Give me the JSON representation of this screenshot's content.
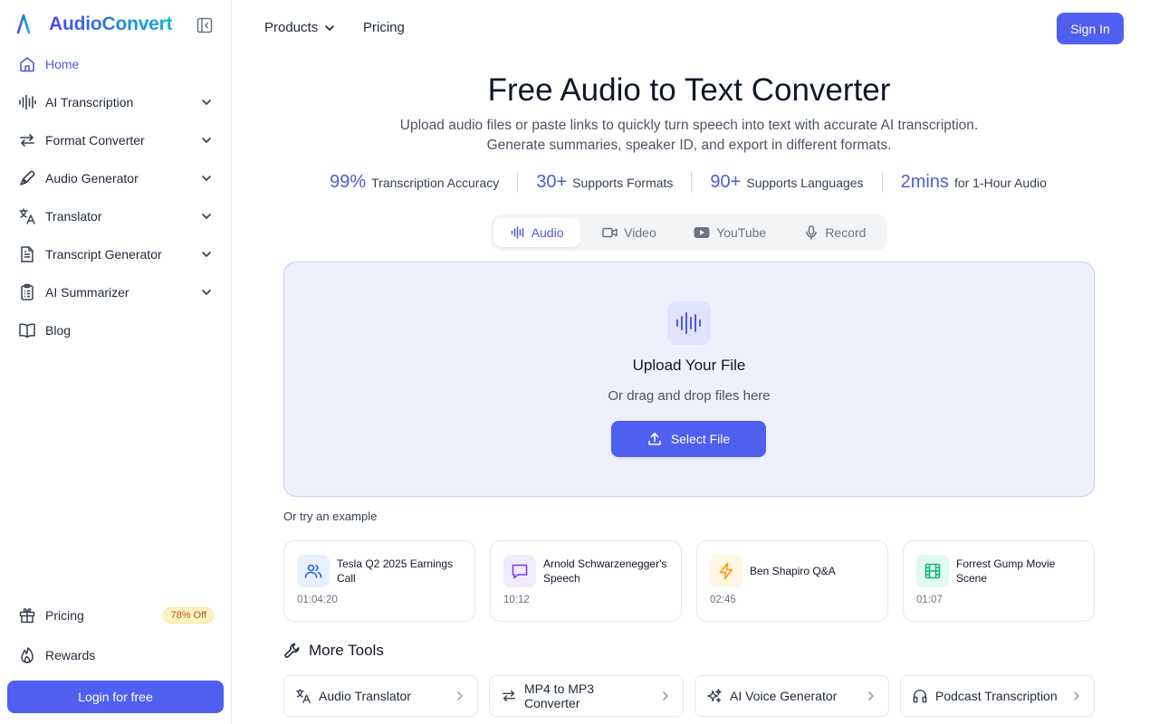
{
  "app": {
    "name": "AudioConvert"
  },
  "sidebar": {
    "items": [
      {
        "label": "Home",
        "icon": "home-icon",
        "active": true,
        "expandable": false
      },
      {
        "label": "AI Transcription",
        "icon": "waveform-icon",
        "expandable": true
      },
      {
        "label": "Format Converter",
        "icon": "swap-arrows-icon",
        "expandable": true
      },
      {
        "label": "Audio Generator",
        "icon": "pen-icon",
        "expandable": true
      },
      {
        "label": "Translator",
        "icon": "translate-icon",
        "expandable": true
      },
      {
        "label": "Transcript Generator",
        "icon": "document-icon",
        "expandable": true
      },
      {
        "label": "AI Summarizer",
        "icon": "clipboard-icon",
        "expandable": true
      },
      {
        "label": "Blog",
        "icon": "book-icon",
        "expandable": false
      }
    ],
    "bottom": {
      "pricing_label": "Pricing",
      "pricing_badge": "78% Off",
      "rewards_label": "Rewards"
    },
    "login_label": "Login for free"
  },
  "header": {
    "products_label": "Products",
    "pricing_label": "Pricing",
    "signin_label": "Sign In"
  },
  "hero": {
    "title": "Free Audio to Text Converter",
    "subtitle_line1": "Upload audio files or paste links to quickly turn speech into text with accurate AI transcription.",
    "subtitle_line2": "Generate summaries, speaker ID, and export in different formats."
  },
  "stats": [
    {
      "value": "99%",
      "label": "Transcription Accuracy"
    },
    {
      "value": "30+",
      "label": "Supports Formats"
    },
    {
      "value": "90+",
      "label": "Supports Languages"
    },
    {
      "value": "2mins",
      "label": "for 1-Hour Audio"
    }
  ],
  "tabs": [
    {
      "label": "Audio",
      "active": true
    },
    {
      "label": "Video"
    },
    {
      "label": "YouTube"
    },
    {
      "label": "Record"
    }
  ],
  "upload": {
    "title": "Upload Your File",
    "subtitle": "Or drag and drop files here",
    "button_label": "Select File"
  },
  "examples": {
    "label": "Or try an example",
    "items": [
      {
        "title": "Tesla Q2 2025 Earnings Call",
        "duration": "01:04:20",
        "icon": "users-icon",
        "color": "#2563eb",
        "bg": "#e8f0fe"
      },
      {
        "title": "Arnold Schwarzenegger's Speech",
        "duration": "10:12",
        "icon": "chat-bubble-icon",
        "color": "#7c3aed",
        "bg": "#f1ebfe"
      },
      {
        "title": "Ben Shapiro Q&A",
        "duration": "02:45",
        "icon": "lightning-icon",
        "color": "#f59e0b",
        "bg": "#fef6e4"
      },
      {
        "title": "Forrest Gump Movie Scene",
        "duration": "01:07",
        "icon": "film-icon",
        "color": "#10b981",
        "bg": "#e3f8ef"
      }
    ]
  },
  "more_tools": {
    "title": "More Tools",
    "items": [
      {
        "label": "Audio Translator",
        "icon": "translate-icon"
      },
      {
        "label": "MP4 to MP3 Converter",
        "icon": "swap-arrows-icon"
      },
      {
        "label": "AI Voice Generator",
        "icon": "sparkles-icon"
      },
      {
        "label": "Podcast Transcription",
        "icon": "headphones-icon"
      }
    ]
  },
  "colors": {
    "accent": "#4f5ff0",
    "accent_text": "#4f5bd5",
    "dropzone_bg": "#eef0fe"
  }
}
